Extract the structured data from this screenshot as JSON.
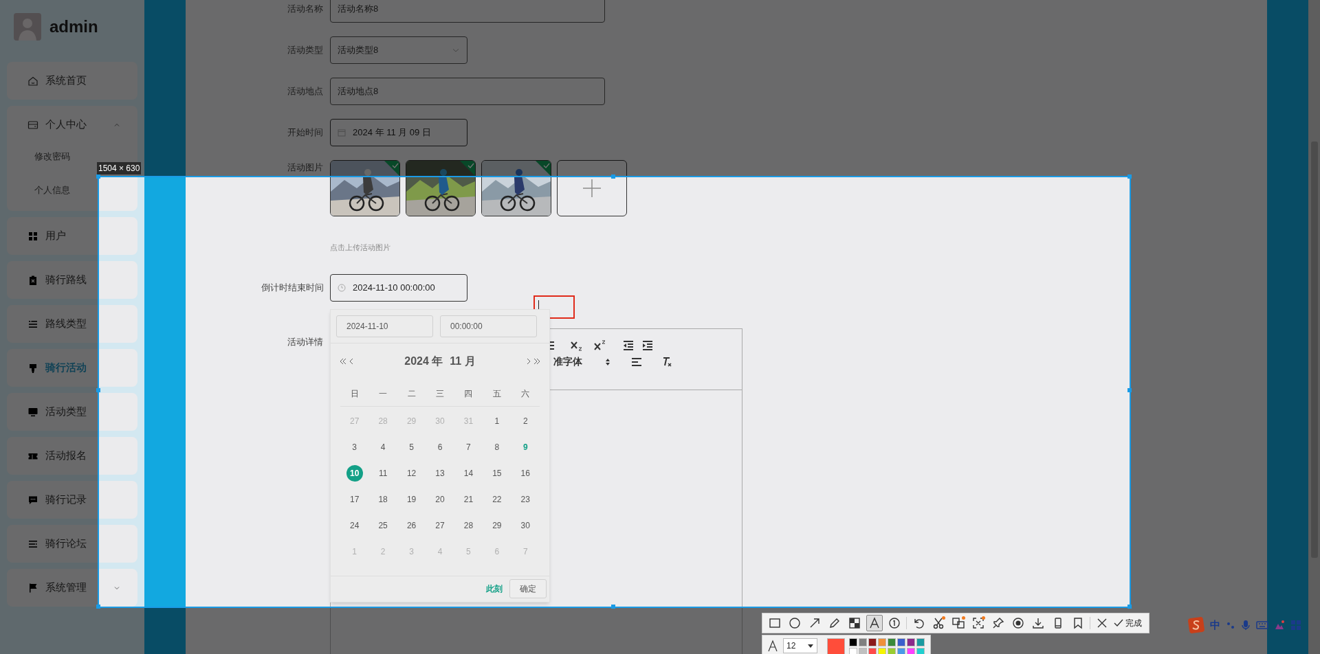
{
  "sidebar": {
    "username": "admin",
    "items": [
      {
        "label": "系统首页",
        "selected": false
      },
      {
        "label": "个人中心",
        "selected": false,
        "expanded": true,
        "children": [
          {
            "label": "修改密码",
            "selected": false
          },
          {
            "label": "个人信息",
            "selected": false
          }
        ]
      },
      {
        "label": "用户",
        "selected": false
      },
      {
        "label": "骑行路线",
        "selected": false
      },
      {
        "label": "路线类型",
        "selected": false
      },
      {
        "label": "骑行活动",
        "selected": true
      },
      {
        "label": "活动类型",
        "selected": false
      },
      {
        "label": "活动报名",
        "selected": false
      },
      {
        "label": "骑行记录",
        "selected": false
      },
      {
        "label": "骑行论坛",
        "selected": false
      },
      {
        "label": "系统管理",
        "selected": false,
        "expanded": false
      }
    ]
  },
  "form": {
    "fields": [
      {
        "label": "活动名称",
        "kind": "text",
        "value": "活动名称8"
      },
      {
        "label": "活动类型",
        "kind": "select",
        "value": "活动类型8"
      },
      {
        "label": "活动地点",
        "kind": "text",
        "value": "活动地点8"
      },
      {
        "label": "开始时间",
        "kind": "date",
        "value": "2024 年 11 月 09 日"
      },
      {
        "label": "活动图片",
        "kind": "images",
        "hint": "点击上传活动图片"
      },
      {
        "label": "倒计时结束时间",
        "kind": "datetime",
        "value": "2024-11-10 00:00:00"
      },
      {
        "label": "活动详情",
        "kind": "editor",
        "font_select": "准字体"
      }
    ]
  },
  "date_picker": {
    "date": "2024-11-10",
    "time": "00:00:00",
    "year": "2024 年",
    "month": "11 月",
    "weekdays": [
      "日",
      "一",
      "二",
      "三",
      "四",
      "五",
      "六"
    ],
    "days": [
      {
        "day": "27",
        "muted": true,
        "today": false,
        "selected": false
      },
      {
        "day": "28",
        "muted": true,
        "today": false,
        "selected": false
      },
      {
        "day": "29",
        "muted": true,
        "today": false,
        "selected": false
      },
      {
        "day": "30",
        "muted": true,
        "today": false,
        "selected": false
      },
      {
        "day": "31",
        "muted": true,
        "today": false,
        "selected": false
      },
      {
        "day": "1",
        "muted": false,
        "today": false,
        "selected": false
      },
      {
        "day": "2",
        "muted": false,
        "today": false,
        "selected": false
      },
      {
        "day": "3",
        "muted": false,
        "today": false,
        "selected": false
      },
      {
        "day": "4",
        "muted": false,
        "today": false,
        "selected": false
      },
      {
        "day": "5",
        "muted": false,
        "today": false,
        "selected": false
      },
      {
        "day": "6",
        "muted": false,
        "today": false,
        "selected": false
      },
      {
        "day": "7",
        "muted": false,
        "today": false,
        "selected": false
      },
      {
        "day": "8",
        "muted": false,
        "today": false,
        "selected": false
      },
      {
        "day": "9",
        "muted": false,
        "today": true,
        "selected": false
      },
      {
        "day": "10",
        "muted": false,
        "today": false,
        "selected": true
      },
      {
        "day": "11",
        "muted": false,
        "today": false,
        "selected": false
      },
      {
        "day": "12",
        "muted": false,
        "today": false,
        "selected": false
      },
      {
        "day": "13",
        "muted": false,
        "today": false,
        "selected": false
      },
      {
        "day": "14",
        "muted": false,
        "today": false,
        "selected": false
      },
      {
        "day": "15",
        "muted": false,
        "today": false,
        "selected": false
      },
      {
        "day": "16",
        "muted": false,
        "today": false,
        "selected": false
      },
      {
        "day": "17",
        "muted": false,
        "today": false,
        "selected": false
      },
      {
        "day": "18",
        "muted": false,
        "today": false,
        "selected": false
      },
      {
        "day": "19",
        "muted": false,
        "today": false,
        "selected": false
      },
      {
        "day": "20",
        "muted": false,
        "today": false,
        "selected": false
      },
      {
        "day": "21",
        "muted": false,
        "today": false,
        "selected": false
      },
      {
        "day": "22",
        "muted": false,
        "today": false,
        "selected": false
      },
      {
        "day": "23",
        "muted": false,
        "today": false,
        "selected": false
      },
      {
        "day": "24",
        "muted": false,
        "today": false,
        "selected": false
      },
      {
        "day": "25",
        "muted": false,
        "today": false,
        "selected": false
      },
      {
        "day": "26",
        "muted": false,
        "today": false,
        "selected": false
      },
      {
        "day": "27",
        "muted": false,
        "today": false,
        "selected": false
      },
      {
        "day": "28",
        "muted": false,
        "today": false,
        "selected": false
      },
      {
        "day": "29",
        "muted": false,
        "today": false,
        "selected": false
      },
      {
        "day": "30",
        "muted": false,
        "today": false,
        "selected": false
      },
      {
        "day": "1",
        "muted": true,
        "today": false,
        "selected": false
      },
      {
        "day": "2",
        "muted": true,
        "today": false,
        "selected": false
      },
      {
        "day": "3",
        "muted": true,
        "today": false,
        "selected": false
      },
      {
        "day": "4",
        "muted": true,
        "today": false,
        "selected": false
      },
      {
        "day": "5",
        "muted": true,
        "today": false,
        "selected": false
      },
      {
        "day": "6",
        "muted": true,
        "today": false,
        "selected": false
      },
      {
        "day": "7",
        "muted": true,
        "today": false,
        "selected": false
      }
    ],
    "now_button": "此刻",
    "confirm_button": "确定"
  },
  "capture": {
    "size_label": "1504 × 630",
    "tools": [
      {
        "selected": false
      },
      {
        "selected": false
      },
      {
        "selected": false
      },
      {
        "selected": false
      },
      {
        "selected": false
      },
      {
        "selected": true
      },
      {
        "selected": false
      },
      {
        "selected": false
      },
      {
        "selected": false
      },
      {
        "selected": false
      },
      {
        "selected": false
      },
      {
        "selected": false
      },
      {
        "selected": false
      },
      {
        "selected": false
      },
      {
        "selected": false
      },
      {
        "selected": false
      }
    ],
    "done_button": "完成",
    "font_size": "12",
    "current": {
      "color": "#ff4d3a"
    },
    "palette": [
      {
        "color": "#000000"
      },
      {
        "color": "#808080"
      },
      {
        "color": "#8b1a1a"
      },
      {
        "color": "#f0903a"
      },
      {
        "color": "#3a8a3a"
      },
      {
        "color": "#3a5fcd"
      },
      {
        "color": "#8b2a8b"
      },
      {
        "color": "#1a9aa0"
      },
      {
        "color": "#ffffff"
      },
      {
        "color": "#c0c0c0"
      },
      {
        "color": "#ff4a4a"
      },
      {
        "color": "#f5f500"
      },
      {
        "color": "#9acd32"
      },
      {
        "color": "#4a9ae8"
      },
      {
        "color": "#ff40ff"
      },
      {
        "color": "#20d0d0"
      }
    ]
  },
  "ime": {
    "mode": "中"
  }
}
